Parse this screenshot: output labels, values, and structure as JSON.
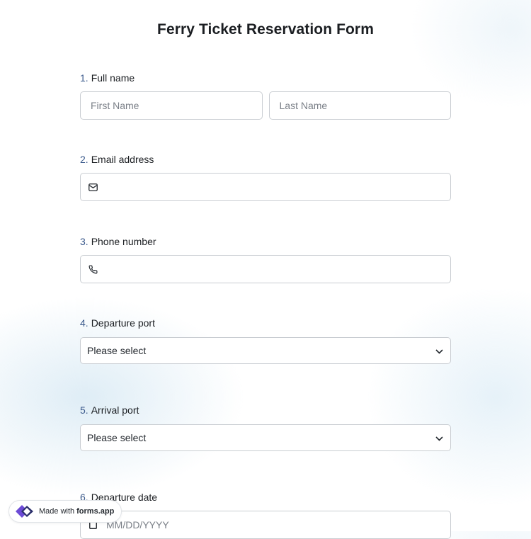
{
  "form": {
    "title": "Ferry Ticket Reservation Form",
    "questions": [
      {
        "number": "1.",
        "label": "Full name",
        "first_placeholder": "First Name",
        "last_placeholder": "Last Name"
      },
      {
        "number": "2.",
        "label": "Email address",
        "icon": "envelope-icon"
      },
      {
        "number": "3.",
        "label": "Phone number",
        "icon": "phone-icon"
      },
      {
        "number": "4.",
        "label": "Departure port",
        "selected": "Please select"
      },
      {
        "number": "5.",
        "label": "Arrival port",
        "selected": "Please select"
      },
      {
        "number": "6.",
        "label": "Departure date",
        "placeholder": "MM/DD/YYYY",
        "icon": "calendar-icon"
      }
    ]
  },
  "badge": {
    "prefix": "Made with",
    "brand": "forms.app"
  },
  "colors": {
    "number": "#3b5a8c",
    "border": "#c9cdd2",
    "logo_purple": "#6c4bd6",
    "logo_dark": "#2b2f6b"
  }
}
